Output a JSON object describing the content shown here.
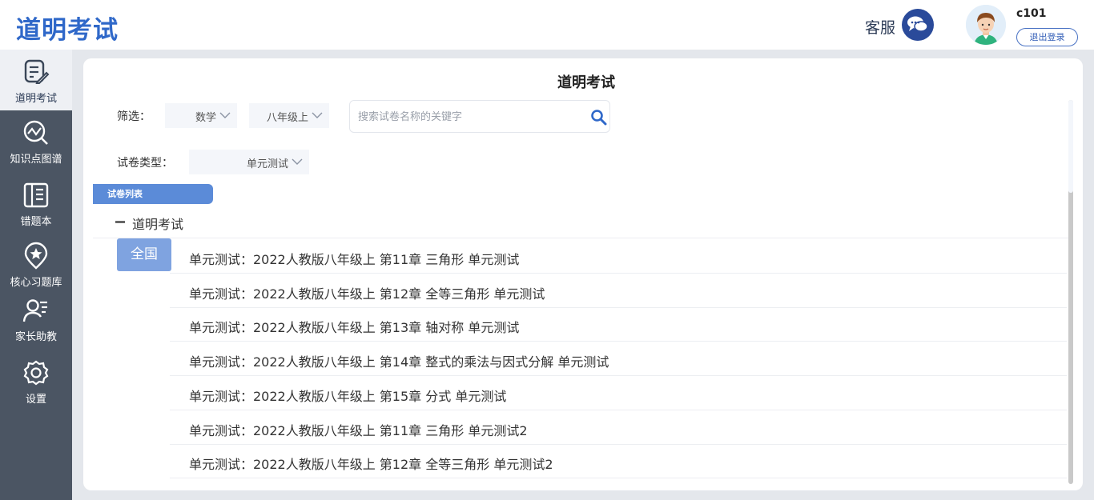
{
  "header": {
    "logo": "道明考试",
    "service_label": "客服",
    "username": "c101",
    "logout_label": "退出登录"
  },
  "sidebar": {
    "items": [
      {
        "label": "道明考试",
        "icon": "exam-edit-icon",
        "active": true
      },
      {
        "label": "知识点图谱",
        "icon": "knowledge-chart-icon",
        "active": false
      },
      {
        "label": "错题本",
        "icon": "notebook-icon",
        "active": false
      },
      {
        "label": "核心习题库",
        "icon": "star-badge-icon",
        "active": false
      },
      {
        "label": "家长助教",
        "icon": "parent-user-icon",
        "active": false
      },
      {
        "label": "设置",
        "icon": "gear-icon",
        "active": false
      }
    ]
  },
  "main": {
    "title": "道明考试",
    "filter_label": "筛选：",
    "subject_select": "数学",
    "grade_select": "八年级上",
    "search_placeholder": "搜索试卷名称的关键字",
    "type_label": "试卷类型：",
    "type_select": "单元测试",
    "list_tab": "试卷列表",
    "tree_title": "道明考试",
    "region_button": "全国",
    "papers": [
      "单元测试：2022人教版八年级上 第11章 三角形 单元测试",
      "单元测试：2022人教版八年级上 第12章 全等三角形 单元测试",
      "单元测试：2022人教版八年级上 第13章 轴对称 单元测试",
      "单元测试：2022人教版八年级上 第14章 整式的乘法与因式分解 单元测试",
      "单元测试：2022人教版八年级上 第15章 分式 单元测试",
      "单元测试：2022人教版八年级上 第11章 三角形 单元测试2",
      "单元测试：2022人教版八年级上 第12章 全等三角形 单元测试2"
    ]
  },
  "colors": {
    "brand": "#2f68c9",
    "sidebar_bg": "#4b5563",
    "tab_blue": "#5b8bd8",
    "region_blue": "#7fa3e0",
    "service_btn": "#2a4a9a"
  }
}
